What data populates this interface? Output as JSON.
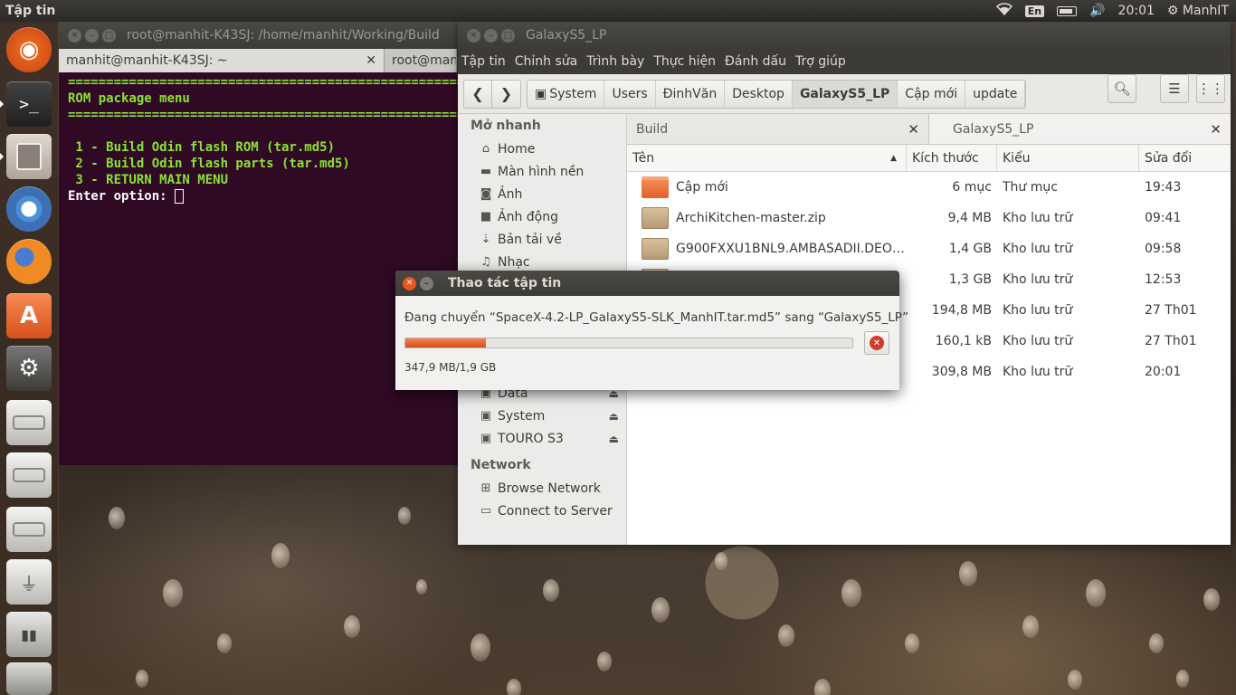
{
  "top_panel": {
    "app_title": "Tập tin",
    "keyboard": "En",
    "time": "20:01",
    "user": "ManhIT"
  },
  "launcher": [
    {
      "name": "dash",
      "icon": "ubuntu-logo-icon"
    },
    {
      "name": "terminal",
      "icon": "terminal-icon"
    },
    {
      "name": "files",
      "icon": "file-cabinet-icon"
    },
    {
      "name": "chromium",
      "icon": "chromium-icon"
    },
    {
      "name": "firefox",
      "icon": "firefox-icon"
    },
    {
      "name": "software-center",
      "icon": "shopping-bag-icon"
    },
    {
      "name": "system-settings",
      "icon": "settings-wrench-icon"
    },
    {
      "name": "drive-1",
      "icon": "hard-drive-icon"
    },
    {
      "name": "drive-2",
      "icon": "hard-drive-icon"
    },
    {
      "name": "drive-3",
      "icon": "hard-drive-icon"
    },
    {
      "name": "usb-drive",
      "icon": "usb-drive-icon"
    },
    {
      "name": "media-player",
      "icon": "media-player-icon"
    },
    {
      "name": "trash",
      "icon": "trash-icon"
    }
  ],
  "terminal": {
    "title": "root@manhit-K43SJ: /home/manhit/Working/Build",
    "tabs": [
      "manhit@manhit-K43SJ: ~",
      "root@manhit-K43SJ: /home/manhit/Working/Build"
    ],
    "lines": {
      "rule1": "==========================================================",
      "heading": "ROM package menu",
      "rule2": "==========================================================",
      "opt1": " 1 - Build Odin flash ROM (tar.md5)",
      "opt2": " 2 - Build Odin flash parts (tar.md5)",
      "opt3": " 3 - RETURN MAIN MENU",
      "prompt": "Enter option: "
    }
  },
  "files": {
    "title": "GalaxyS5_LP",
    "menu": [
      "Tập tin",
      "Chỉnh sửa",
      "Trình bày",
      "Thực hiện",
      "Đánh dấu",
      "Trợ giúp"
    ],
    "breadcrumbs": [
      "System",
      "Users",
      "ĐinhVăn",
      "Desktop",
      "GalaxyS5_LP",
      "Cập mới",
      "update"
    ],
    "current_crumb": "GalaxyS5_LP",
    "sidebar": {
      "quick_heading": "Mở nhanh",
      "quick": [
        {
          "label": "Home",
          "icon": "home-icon"
        },
        {
          "label": "Màn hình nền",
          "icon": "desktop-folder-icon"
        },
        {
          "label": "Ảnh",
          "icon": "camera-icon"
        },
        {
          "label": "Ảnh động",
          "icon": "video-icon"
        },
        {
          "label": "Bản tải về",
          "icon": "download-icon"
        },
        {
          "label": "Nhạc",
          "icon": "music-icon"
        }
      ],
      "devices": [
        {
          "label": "Data",
          "icon": "drive-icon"
        },
        {
          "label": "System",
          "icon": "drive-icon"
        },
        {
          "label": "TOURO S3",
          "icon": "drive-icon"
        }
      ],
      "network_heading": "Network",
      "network": [
        {
          "label": "Browse Network",
          "icon": "network-icon"
        },
        {
          "label": "Connect to Server",
          "icon": "server-icon"
        }
      ]
    },
    "tabs": [
      "Build",
      "GalaxyS5_LP"
    ],
    "columns": {
      "name": "Tên",
      "size": "Kích thước",
      "type": "Kiểu",
      "modified": "Sửa đổi"
    },
    "rows": [
      {
        "name": "Cập mới",
        "size": "6 mục",
        "type": "Thư mục",
        "modified": "19:43",
        "kind": "folder"
      },
      {
        "name": "ArchiKitchen-master.zip",
        "size": "9,4 MB",
        "type": "Kho lưu trữ",
        "modified": "09:41",
        "kind": "zip"
      },
      {
        "name": "G900FXXU1BNL9.AMBASADII.DEO…",
        "size": "1,4 GB",
        "type": "Kho lưu trữ",
        "modified": "09:58",
        "kind": "zip"
      },
      {
        "name": "",
        "size": "1,3 GB",
        "type": "Kho lưu trữ",
        "modified": "12:53",
        "kind": "zip"
      },
      {
        "name": "",
        "size": "194,8 MB",
        "type": "Kho lưu trữ",
        "modified": "27 Th01",
        "kind": "zip"
      },
      {
        "name": "",
        "size": "160,1 kB",
        "type": "Kho lưu trữ",
        "modified": "27 Th01",
        "kind": "zip"
      },
      {
        "name": "",
        "size": "309,8 MB",
        "type": "Kho lưu trữ",
        "modified": "20:01",
        "kind": "zip"
      }
    ]
  },
  "dialog": {
    "title": "Thao tác tập tin",
    "message": "Đang chuyển “SpaceX-4.2-LP_GalaxyS5-SLK_ManhIT.tar.md5” sang “GalaxyS5_LP”",
    "status": "347,9 MB/1,9 GB",
    "progress": 0.18,
    "accent": "#e95420"
  }
}
